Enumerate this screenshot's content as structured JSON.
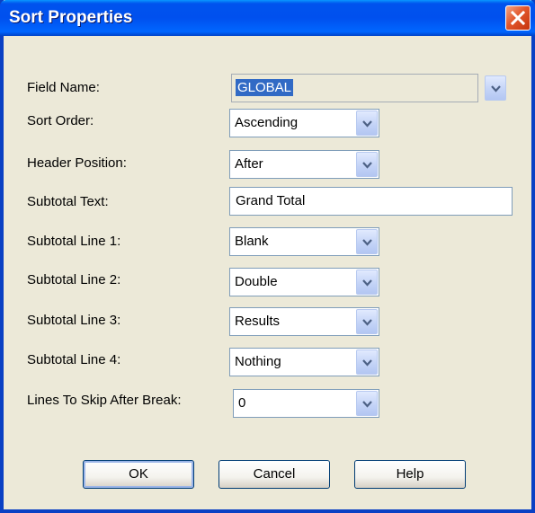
{
  "window": {
    "title": "Sort Properties"
  },
  "fields": {
    "field_name": {
      "label": "Field Name:",
      "value": "GLOBAL"
    },
    "sort_order": {
      "label": "Sort Order:",
      "value": "Ascending"
    },
    "header_position": {
      "label": "Header Position:",
      "value": "After"
    },
    "subtotal_text": {
      "label": "Subtotal Text:",
      "value": "Grand Total"
    },
    "subtotal_line_1": {
      "label": "Subtotal Line 1:",
      "value": "Blank"
    },
    "subtotal_line_2": {
      "label": "Subtotal Line 2:",
      "value": "Double"
    },
    "subtotal_line_3": {
      "label": "Subtotal Line 3:",
      "value": "Results"
    },
    "subtotal_line_4": {
      "label": "Subtotal Line 4:",
      "value": "Nothing"
    },
    "lines_to_skip": {
      "label": "Lines To Skip After Break:",
      "value": "0"
    }
  },
  "buttons": {
    "ok": "OK",
    "cancel": "Cancel",
    "help": "Help"
  },
  "icons": {
    "close": "close-icon",
    "dropdown": "chevron-down-icon"
  },
  "colors": {
    "titlebar": "#0054e3",
    "close": "#e2572c",
    "face": "#ece9d8",
    "selection": "#316ac5"
  }
}
